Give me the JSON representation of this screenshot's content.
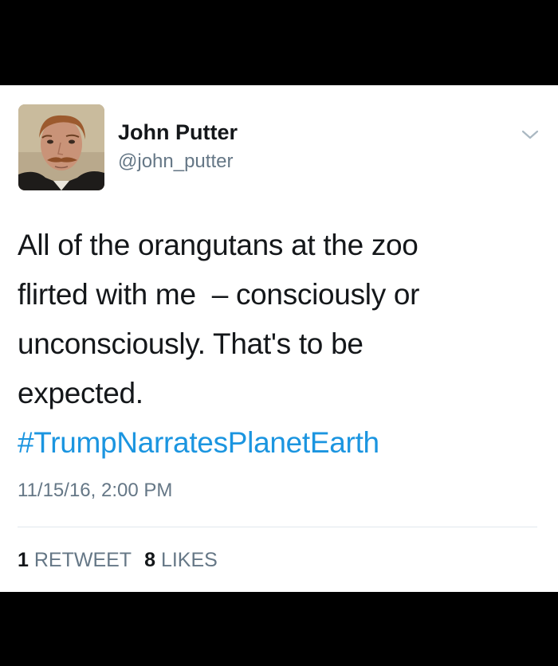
{
  "tweet": {
    "author": {
      "display_name": "John Putter",
      "handle": "@john_putter",
      "avatar": "portrait-avatar"
    },
    "menu_icon": "chevron-down-icon",
    "text_lines": [
      "All of the orangutans at the zoo",
      "flirted with me  – consciously or",
      "unconsciously. That's to be",
      "expected."
    ],
    "hashtag": "#TrumpNarratesPlanetEarth",
    "timestamp": "11/15/16, 2:00 PM",
    "stats": {
      "retweets_count": "1",
      "retweets_label": "RETWEET",
      "likes_count": "8",
      "likes_label": "LIKES"
    }
  },
  "colors": {
    "background": "#000000",
    "card": "#ffffff",
    "text": "#14171a",
    "secondary": "#657786",
    "link": "#1b95e0",
    "divider": "#e1e8ed"
  }
}
